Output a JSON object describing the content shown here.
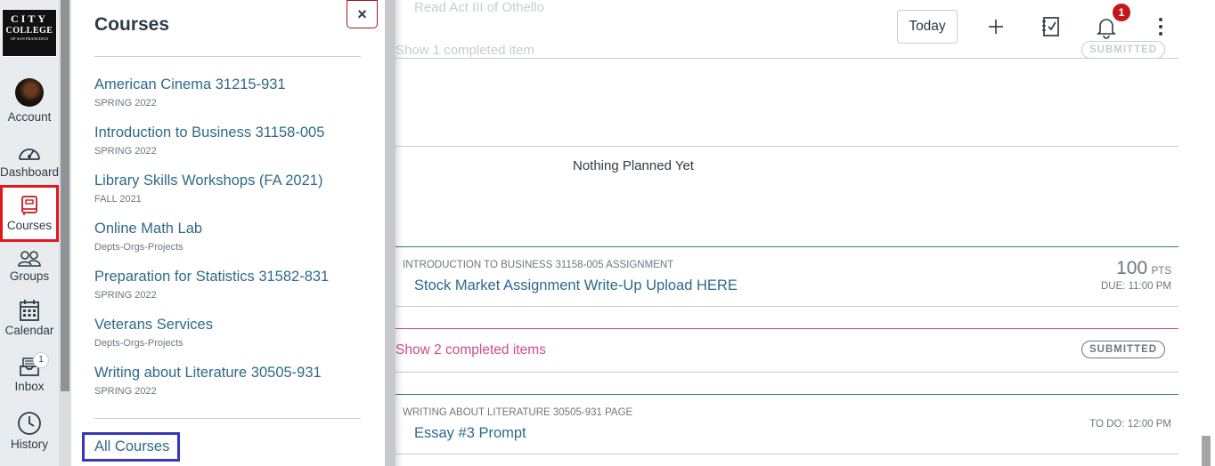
{
  "global_nav": {
    "logo": {
      "line1": "CITY",
      "line2": "COLLEGE",
      "line3": "OF SAN FRANCISCO"
    },
    "items": [
      {
        "label": "Account",
        "icon": "avatar"
      },
      {
        "label": "Dashboard",
        "icon": "dashboard-icon"
      },
      {
        "label": "Courses",
        "icon": "book-icon"
      },
      {
        "label": "Groups",
        "icon": "groups-icon"
      },
      {
        "label": "Calendar",
        "icon": "calendar-icon"
      },
      {
        "label": "Inbox",
        "icon": "inbox-icon",
        "badge": "1"
      },
      {
        "label": "History",
        "icon": "clock-icon"
      }
    ]
  },
  "tray": {
    "title": "Courses",
    "close_label": "×",
    "courses": [
      {
        "name": "American Cinema 31215-931",
        "term": "SPRING 2022"
      },
      {
        "name": "Introduction to Business 31158-005",
        "term": "SPRING 2022"
      },
      {
        "name": "Library Skills Workshops (FA 2021)",
        "term": "FALL 2021"
      },
      {
        "name": "Online Math Lab",
        "term": "Depts-Orgs-Projects"
      },
      {
        "name": "Preparation for Statistics 31582-831",
        "term": "SPRING 2022"
      },
      {
        "name": "Veterans Services",
        "term": "Depts-Orgs-Projects"
      },
      {
        "name": "Writing about Literature 30505-931",
        "term": "SPRING 2022"
      }
    ],
    "all_courses_label": "All Courses"
  },
  "header": {
    "today_label": "Today",
    "notification_count": "1"
  },
  "planner": {
    "faded_top_title": "Read Act III of Othello",
    "faded_completed": "Show 1 completed item",
    "faded_pill": "SUBMITTED",
    "empty_day": "Nothing Planned Yet",
    "item1": {
      "context": "INTRODUCTION TO BUSINESS 31158-005 ASSIGNMENT",
      "title": "Stock Market Assignment Write-Up Upload HERE",
      "points": "100",
      "points_unit": "PTS",
      "due": "DUE: 11:00 PM"
    },
    "completed": {
      "label": "Show 2 completed items",
      "status": "SUBMITTED"
    },
    "item2": {
      "context": "WRITING ABOUT LITERATURE 30505-931 PAGE",
      "title": "Essay #3 Prompt",
      "due": "TO DO: 12:00 PM"
    }
  }
}
